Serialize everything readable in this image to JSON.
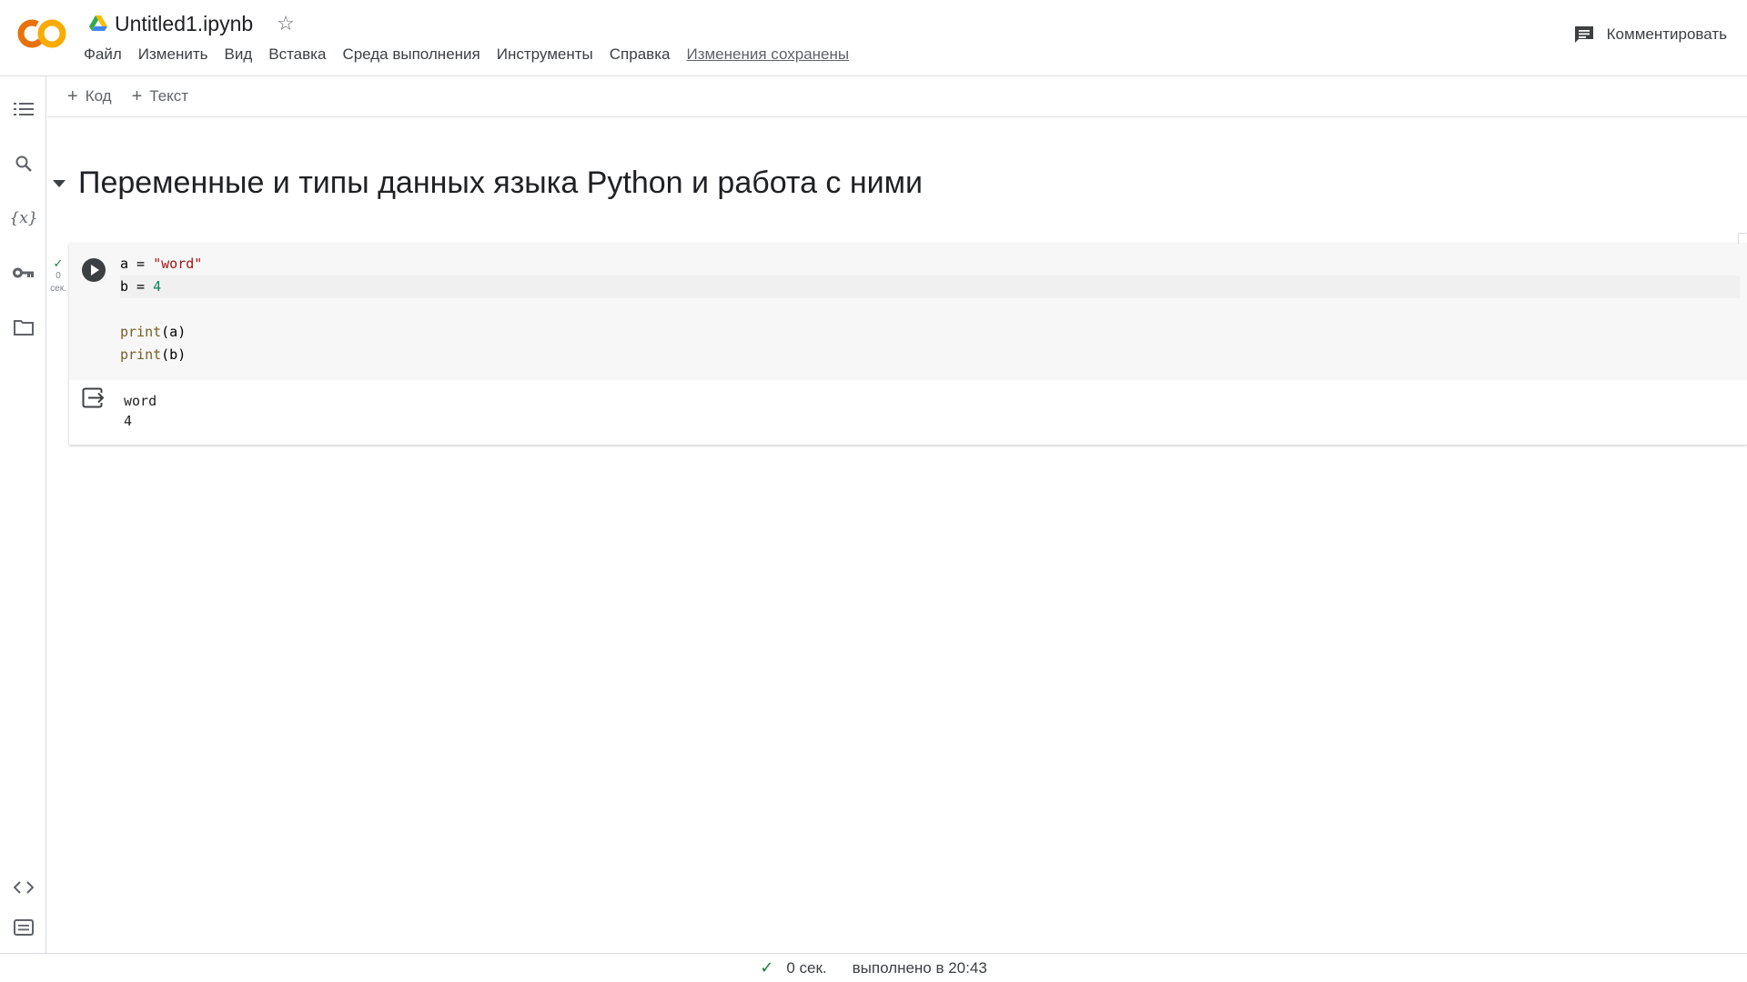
{
  "app": {
    "logo_text": "CO",
    "doc_title": "Untitled1.ipynb",
    "save_status": "Изменения сохранены",
    "comment_label": "Комментировать"
  },
  "menu": [
    "Файл",
    "Изменить",
    "Вид",
    "Вставка",
    "Среда выполнения",
    "Инструменты",
    "Справка"
  ],
  "toolbar": {
    "add_code": "Код",
    "add_text": "Текст"
  },
  "sidebar": {
    "icons": [
      "table-of-contents-icon",
      "search-icon",
      "variables-icon",
      "secrets-key-icon",
      "files-folder-icon",
      "code-snippets-icon",
      "command-palette-icon"
    ],
    "variables_glyph": "{x}"
  },
  "notebook": {
    "section_title": "Переменные и типы данных языка Python и работа с ними",
    "cell": {
      "exec_status_time": "0",
      "exec_status_unit": "сек.",
      "code_lines": [
        "a = \"word\"",
        "b = 4",
        "",
        "print(a)",
        "print(b)"
      ],
      "output": "word\n4"
    }
  },
  "statusbar": {
    "duration": "0 сек.",
    "completed": "выполнено в 20:43"
  },
  "colors": {
    "logo_orange": "#F9AB00",
    "logo_dark_orange": "#E8710A",
    "string": "#a31515",
    "number": "#098658",
    "success_green": "#188038"
  }
}
